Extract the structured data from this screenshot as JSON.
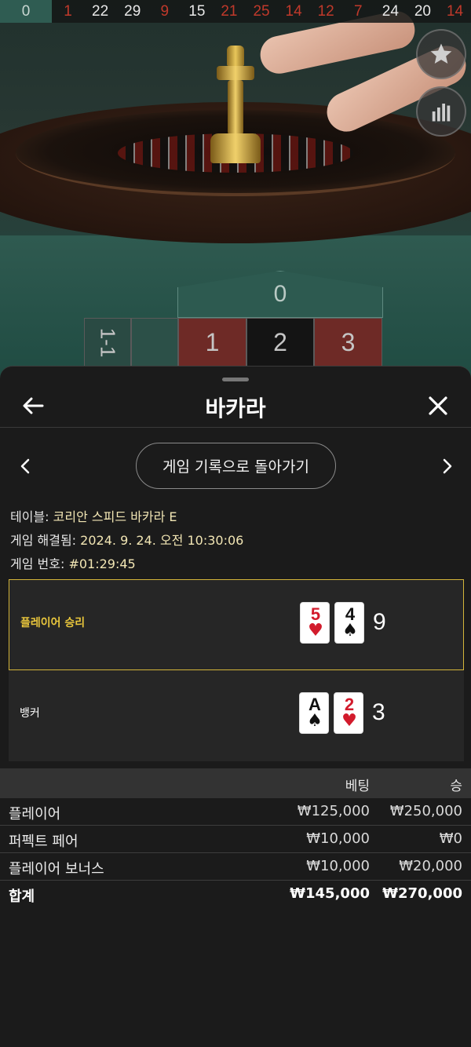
{
  "history": [
    {
      "n": "0",
      "color": "#c9d7d2"
    },
    {
      "n": "1",
      "color": "#c0392b"
    },
    {
      "n": "22",
      "color": "#e8e8e8"
    },
    {
      "n": "29",
      "color": "#e8e8e8"
    },
    {
      "n": "9",
      "color": "#c0392b"
    },
    {
      "n": "15",
      "color": "#e8e8e8"
    },
    {
      "n": "21",
      "color": "#c0392b"
    },
    {
      "n": "25",
      "color": "#c0392b"
    },
    {
      "n": "14",
      "color": "#c0392b"
    },
    {
      "n": "12",
      "color": "#c0392b"
    },
    {
      "n": "7",
      "color": "#c0392b"
    },
    {
      "n": "24",
      "color": "#e8e8e8"
    },
    {
      "n": "20",
      "color": "#e8e8e8"
    },
    {
      "n": "14",
      "color": "#c0392b"
    }
  ],
  "roulette_table": {
    "zero": "0",
    "column_label": "1-1",
    "numbers": [
      "1",
      "2",
      "3"
    ]
  },
  "side_buttons": {
    "favorite_icon": "star-icon",
    "stats_icon": "bar-chart-icon"
  },
  "sheet": {
    "title": "바카라",
    "back_icon": "arrow-left-icon",
    "close_icon": "close-icon",
    "back_to_history": "게임 기록으로 돌아가기",
    "meta": {
      "table_label": "테이블:",
      "table_value": "코리안 스피드 바카라 E",
      "resolved_label": "게임 해결됨:",
      "resolved_value": "2024. 9. 24. 오전 10:30:06",
      "game_no_label": "게임 번호:",
      "game_no_value": "#01:29:45"
    },
    "results": [
      {
        "label": "플레이어 승리",
        "winner": true,
        "cards": [
          {
            "rank": "5",
            "suit": "♥",
            "color": "red"
          },
          {
            "rank": "4",
            "suit": "♠",
            "color": "black"
          }
        ],
        "score": "9"
      },
      {
        "label": "뱅커",
        "winner": false,
        "cards": [
          {
            "rank": "A",
            "suit": "♠",
            "color": "black"
          },
          {
            "rank": "2",
            "suit": "♥",
            "color": "red"
          }
        ],
        "score": "3"
      }
    ],
    "bets_table": {
      "headers": {
        "bet": "베팅",
        "win": "승"
      },
      "rows": [
        {
          "label": "플레이어",
          "bet": "₩125,000",
          "win": "₩250,000"
        },
        {
          "label": "퍼펙트 페어",
          "bet": "₩10,000",
          "win": "₩0"
        },
        {
          "label": "플레이어 보너스",
          "bet": "₩10,000",
          "win": "₩20,000"
        }
      ],
      "total": {
        "label": "합계",
        "bet": "₩145,000",
        "win": "₩270,000"
      }
    }
  }
}
